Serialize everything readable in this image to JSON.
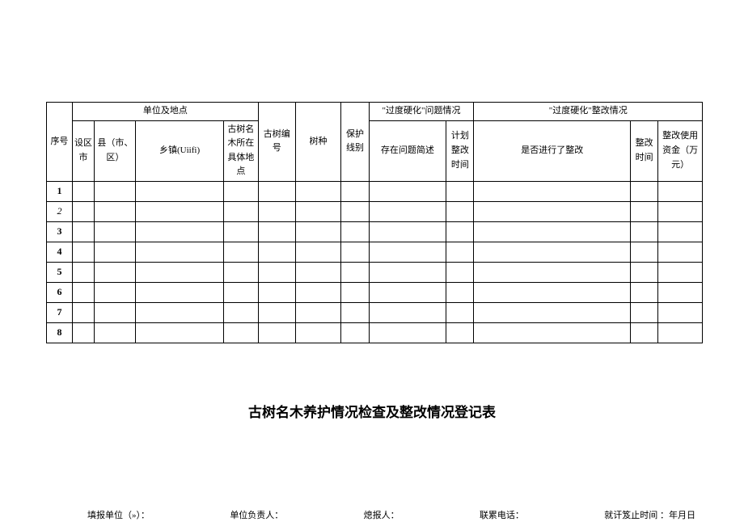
{
  "table": {
    "headers": {
      "seq": "序号",
      "location_group": "单位及地点",
      "city": "设区市",
      "county": "县（市、区）",
      "town": "乡镇(Uiifi)",
      "specific_loc": "古树名木所在具体地点",
      "tree_number": "古树编号",
      "species": "树种",
      "protect_level": "保护线别",
      "problem_group": "\"过度硬化\"问题情况",
      "problem_desc": "存在问题简述",
      "plan_time": "计划整改时间",
      "rectify_group": "\"过度硬化\"整改情况",
      "rectify_done": "是否进行了整改",
      "rectify_time": "整改时间",
      "rectify_fund": "整改使用资金（万元）"
    },
    "rows": [
      "1",
      "2",
      "3",
      "4",
      "5",
      "6",
      "7",
      "8"
    ]
  },
  "title": "古树名木养护情况检查及整改情况登记表",
  "footer": {
    "fill_unit": "填报单位（»）：",
    "unit_head": "单位负责人：",
    "reporter": "熄报人：",
    "contact": "联累电话：",
    "deadline": "就讦笈止时间 ：年月日"
  }
}
